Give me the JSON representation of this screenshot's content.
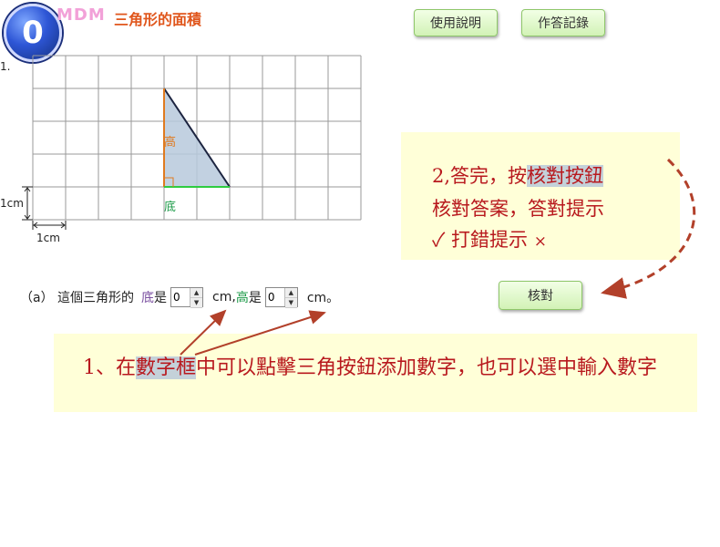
{
  "header": {
    "logo_glyph": "0",
    "brand": "MDM",
    "title": "三角形的面積"
  },
  "toolbar": {
    "instructions_label": "使用說明",
    "answer_log_label": "作答記錄",
    "check_label": "核對"
  },
  "question": {
    "number": "1.",
    "height_label": "高",
    "base_label": "底",
    "unit_vertical": "1cm",
    "unit_horizontal": "1cm",
    "prompt_prefix": "（a） 這個三角形的",
    "base_word": "底",
    "is_word": "是",
    "base_value": "0",
    "unit1": "cm,",
    "height_word": "高",
    "height_is": "是",
    "height_value": "0",
    "unit2": "cm。"
  },
  "callout_check": {
    "line1_pre": "2,答完，按",
    "line1_hl": "核對按鈕",
    "line2": "核對答案，答對提示",
    "line3_check": "✓",
    "line3_text": "打錯提示",
    "line3_cross": "×"
  },
  "callout_input": {
    "pre": "1、在",
    "hl": "數字框",
    "post": "中可以點擊三角按鈕添加數字，也可以選中輸入數字"
  },
  "colors": {
    "callout_bg": "#ffffd8",
    "callout_text": "#b8191e",
    "arrow": "#b2402a",
    "triangle_fill": "#b7c9dc",
    "height_line": "#e07a1f",
    "base_line": "#2ecc40"
  }
}
